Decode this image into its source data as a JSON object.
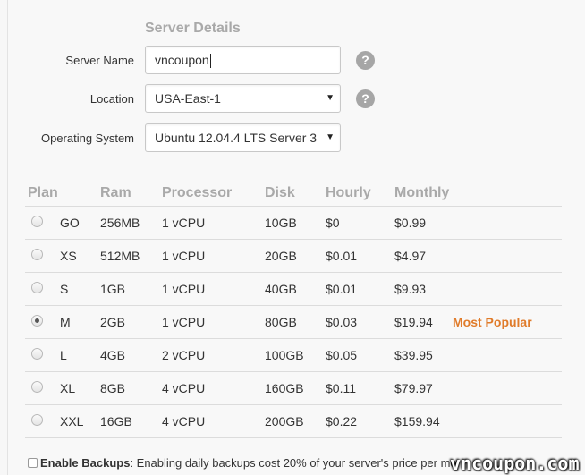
{
  "form": {
    "title": "Server Details",
    "server_name_label": "Server Name",
    "server_name_value": "vncoupon",
    "location_label": "Location",
    "location_value": "USA-East-1",
    "os_label": "Operating System",
    "os_value": "Ubuntu 12.04.4 LTS Server 3",
    "help_glyph": "?"
  },
  "plans": {
    "headers": [
      "Plan",
      "Ram",
      "Processor",
      "Disk",
      "Hourly",
      "Monthly"
    ],
    "selected": "M",
    "rows": [
      {
        "plan": "GO",
        "ram": "256MB",
        "processor": "1 vCPU",
        "disk": "10GB",
        "hourly": "$0",
        "monthly": "$0.99",
        "badge": ""
      },
      {
        "plan": "XS",
        "ram": "512MB",
        "processor": "1 vCPU",
        "disk": "20GB",
        "hourly": "$0.01",
        "monthly": "$4.97",
        "badge": ""
      },
      {
        "plan": "S",
        "ram": "1GB",
        "processor": "1 vCPU",
        "disk": "40GB",
        "hourly": "$0.01",
        "monthly": "$9.93",
        "badge": ""
      },
      {
        "plan": "M",
        "ram": "2GB",
        "processor": "1 vCPU",
        "disk": "80GB",
        "hourly": "$0.03",
        "monthly": "$19.94",
        "badge": "Most Popular"
      },
      {
        "plan": "L",
        "ram": "4GB",
        "processor": "2 vCPU",
        "disk": "100GB",
        "hourly": "$0.05",
        "monthly": "$39.95",
        "badge": ""
      },
      {
        "plan": "XL",
        "ram": "8GB",
        "processor": "4 vCPU",
        "disk": "160GB",
        "hourly": "$0.11",
        "monthly": "$79.97",
        "badge": ""
      },
      {
        "plan": "XXL",
        "ram": "16GB",
        "processor": "4 vCPU",
        "disk": "200GB",
        "hourly": "$0.22",
        "monthly": "$159.94",
        "badge": ""
      }
    ]
  },
  "backups": {
    "label": "Enable Backups",
    "description": ": Enabling daily backups cost 20% of your server's price per mo",
    "checked": false
  },
  "watermark": "vncoupon.com",
  "colors": {
    "accent_badge": "#e07b2a",
    "header_gray": "#a9a9a9"
  }
}
